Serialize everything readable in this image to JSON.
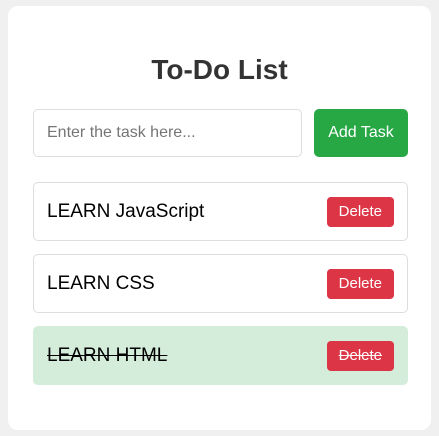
{
  "app": {
    "title": "To-Do List"
  },
  "input": {
    "placeholder": "Enter the task here...",
    "value": ""
  },
  "add_button": {
    "label": "Add Task"
  },
  "tasks": [
    {
      "text": "LEARN JavaScript",
      "completed": false,
      "delete_label": "Delete"
    },
    {
      "text": "LEARN CSS",
      "completed": false,
      "delete_label": "Delete"
    },
    {
      "text": "LEARN HTML",
      "completed": true,
      "delete_label": "Delete"
    }
  ],
  "colors": {
    "add_button": "#28a745",
    "delete_button": "#dc3545",
    "completed_background": "#d4edda"
  }
}
